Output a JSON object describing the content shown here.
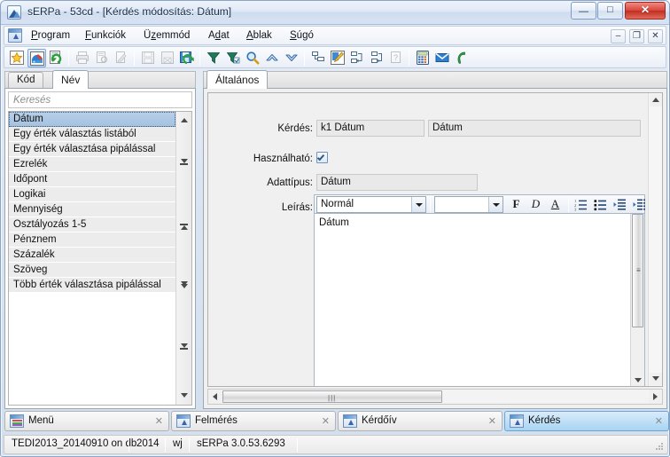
{
  "window": {
    "title": "sERPa - 53cd - [Kérdés módosítás: Dátum]",
    "icon": "mountain-app-icon",
    "minimize_label": "—",
    "maximize_label": "□",
    "close_label": "✕"
  },
  "mdi_child": {
    "minimize_label": "–",
    "restore_label": "❐",
    "close_label": "✕"
  },
  "menubar": {
    "app_icon": "window-up-arrow-icon",
    "items": [
      {
        "label": "Program",
        "accel": "P"
      },
      {
        "label": "Funkciók",
        "accel": "F"
      },
      {
        "label": "Üzemmód",
        "accel": "z"
      },
      {
        "label": "Adat",
        "accel": "d"
      },
      {
        "label": "Ablak",
        "accel": "A"
      },
      {
        "label": "Súgó",
        "accel": "S"
      }
    ]
  },
  "toolbar": {
    "buttons": [
      {
        "name": "favorite-star-icon",
        "enabled": true,
        "active": false
      },
      {
        "name": "palette-paint-icon",
        "enabled": true,
        "active": true
      },
      {
        "name": "refresh-page-icon",
        "enabled": true,
        "active": false
      },
      {
        "name": "print-icon",
        "enabled": false,
        "active": false
      },
      {
        "name": "print-preview-icon",
        "enabled": false,
        "active": false
      },
      {
        "name": "print-setup-icon",
        "enabled": false,
        "active": false
      },
      {
        "name": "save-icon",
        "enabled": false,
        "active": false
      },
      {
        "name": "export-excel-icon",
        "enabled": false,
        "active": false
      },
      {
        "name": "save-as-icon",
        "enabled": true,
        "active": false
      },
      {
        "name": "filter-icon",
        "enabled": true,
        "active": false
      },
      {
        "name": "filter-edit-icon",
        "enabled": true,
        "active": false
      },
      {
        "name": "search-magnifier-icon",
        "enabled": true,
        "active": false
      },
      {
        "name": "collapse-up-icon",
        "enabled": true,
        "active": false
      },
      {
        "name": "expand-down-icon",
        "enabled": true,
        "active": false
      },
      {
        "name": "indent-list-icon",
        "enabled": true,
        "active": false
      },
      {
        "name": "edit-pencil-icon",
        "enabled": true,
        "active": false
      },
      {
        "name": "copy-record-icon",
        "enabled": true,
        "active": false
      },
      {
        "name": "paste-record-icon",
        "enabled": true,
        "active": false
      },
      {
        "name": "help-page-icon",
        "enabled": false,
        "active": false
      },
      {
        "name": "calculator-icon",
        "enabled": true,
        "active": false
      },
      {
        "name": "mail-envelope-icon",
        "enabled": true,
        "active": false
      },
      {
        "name": "phone-icon",
        "enabled": true,
        "active": false
      }
    ]
  },
  "left_panel": {
    "tabs": [
      {
        "label": "Kód",
        "selected": false
      },
      {
        "label": "Név",
        "selected": true
      }
    ],
    "search": {
      "placeholder": "Keresés",
      "value": ""
    },
    "list_items": [
      {
        "label": "Dátum",
        "selected": true
      },
      {
        "label": "Egy érték választás listából",
        "selected": false
      },
      {
        "label": "Egy érték választása pipálással",
        "selected": false
      },
      {
        "label": "Ezrelék",
        "selected": false
      },
      {
        "label": "Időpont",
        "selected": false
      },
      {
        "label": "Logikai",
        "selected": false
      },
      {
        "label": "Mennyiség",
        "selected": false
      },
      {
        "label": "Osztályozás 1-5",
        "selected": false
      },
      {
        "label": "Pénznem",
        "selected": false
      },
      {
        "label": "Százalék",
        "selected": false
      },
      {
        "label": "Szöveg",
        "selected": false
      },
      {
        "label": "Több érték választása pipálással",
        "selected": false
      }
    ],
    "nav_buttons": [
      "scroll-up-icon",
      "page-up-icon",
      "first-record-icon",
      "last-record-icon",
      "page-down-icon",
      "scroll-down-icon"
    ]
  },
  "right_panel": {
    "tabs": [
      {
        "label": "Általános",
        "selected": true
      }
    ],
    "fields": {
      "kerdes_label": "Kérdés:",
      "kerdes_code": "k1 Dátum",
      "kerdes_name": "Dátum",
      "hasznalhato_label": "Használható:",
      "hasznalhato_checked": true,
      "adattipus_label": "Adattípus:",
      "adattipus_value": "Dátum",
      "leiras_label": "Leírás:"
    },
    "rte": {
      "style_combo": "Normál",
      "font_combo": "",
      "buttons": [
        {
          "name": "bold-button",
          "glyph": "F"
        },
        {
          "name": "italic-button",
          "glyph": "D"
        },
        {
          "name": "underline-button",
          "glyph": "A"
        },
        {
          "name": "numbered-list-button",
          "glyph": "list-ol-icon"
        },
        {
          "name": "bulleted-list-button",
          "glyph": "list-ul-icon"
        },
        {
          "name": "outdent-button",
          "glyph": "outdent-icon"
        },
        {
          "name": "indent-button",
          "glyph": "indent-icon"
        }
      ],
      "content": "Dátum"
    }
  },
  "bottom_tabs": [
    {
      "label": "Menü",
      "icon": "menu-window-icon",
      "active": false,
      "close": "✕"
    },
    {
      "label": "Felmérés",
      "icon": "window-up-arrow-icon",
      "active": false,
      "close": "✕"
    },
    {
      "label": "Kérdőív",
      "icon": "window-up-arrow-icon",
      "active": false,
      "close": "✕"
    },
    {
      "label": "Kérdés",
      "icon": "window-up-arrow-icon",
      "active": true,
      "close": "✕"
    }
  ],
  "statusbar": {
    "database": "TEDI2013_20140910 on db",
    "year": "2014",
    "user": "wj",
    "version": "sERPa 3.0.53.6293"
  },
  "colors": {
    "accent": "#2b5c9e",
    "selection": "#a4c2e0",
    "active_tab": "#a9d4f2",
    "close_button": "#c22e20"
  }
}
